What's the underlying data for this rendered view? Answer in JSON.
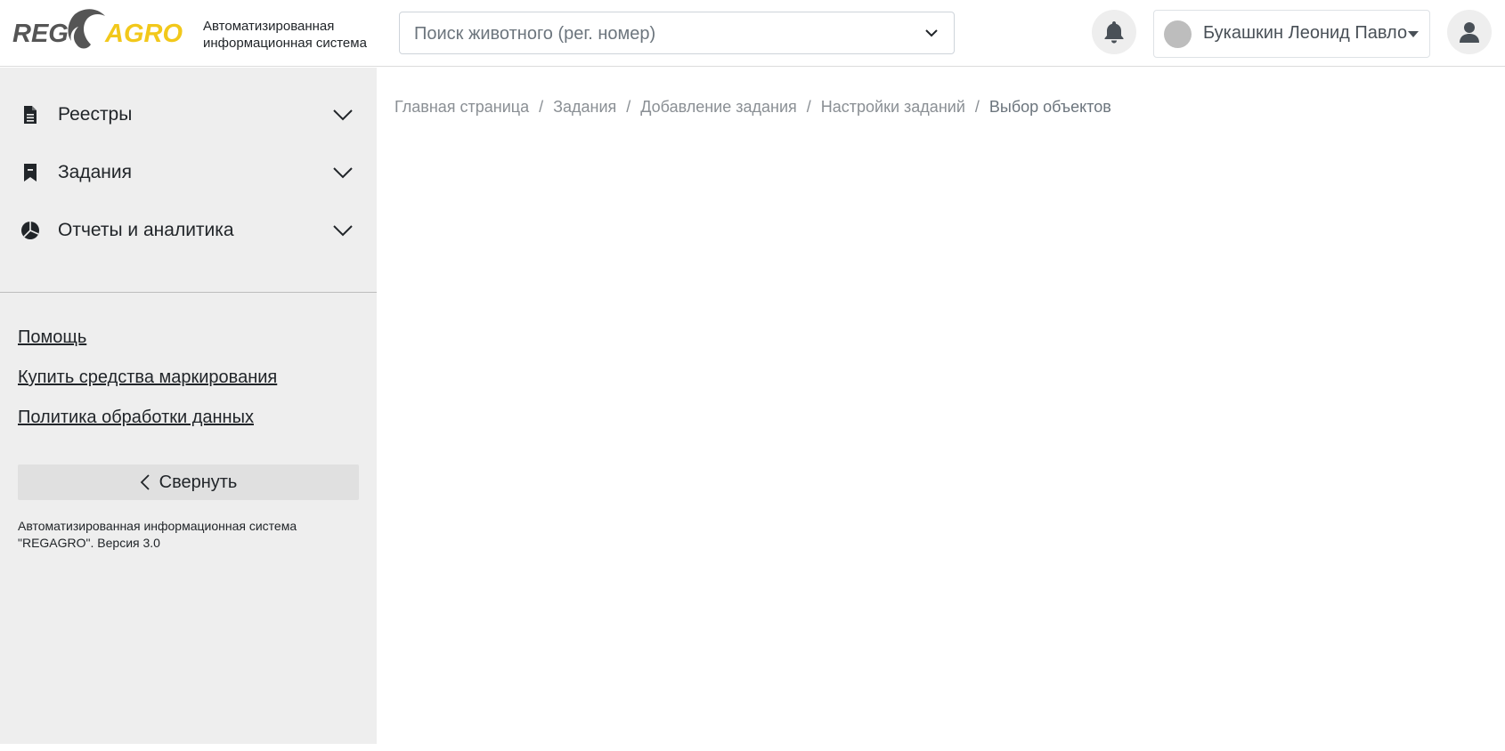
{
  "header": {
    "logo_text": {
      "reg": "REG",
      "agro": "AGRO"
    },
    "system_title_line1": "Автоматизированная",
    "system_title_line2": "информационная система",
    "search_placeholder": "Поиск животного (рег. номер)",
    "user_name": "Букашкин Леонид Павло"
  },
  "sidebar": {
    "items": [
      {
        "label": "Реестры",
        "icon": "document-icon"
      },
      {
        "label": "Задания",
        "icon": "bookmark-icon"
      },
      {
        "label": "Отчеты и аналитика",
        "icon": "pie-chart-icon"
      }
    ],
    "links": [
      {
        "label": "Помощь"
      },
      {
        "label": "Купить средства маркирования"
      },
      {
        "label": "Политика обработки данных"
      }
    ],
    "collapse_label": "Свернуть",
    "footer_line1": "Автоматизированная информационная система",
    "footer_line2": "\"REGAGRO\". Версия 3.0"
  },
  "breadcrumb": {
    "items": [
      "Главная страница",
      "Задания",
      "Добавление задания",
      "Настройки заданий"
    ],
    "current": "Выбор объектов",
    "separator": "/"
  },
  "colors": {
    "brand_yellow": "#f2c81b",
    "sidebar_bg": "#eeeeee",
    "text": "#212529"
  }
}
